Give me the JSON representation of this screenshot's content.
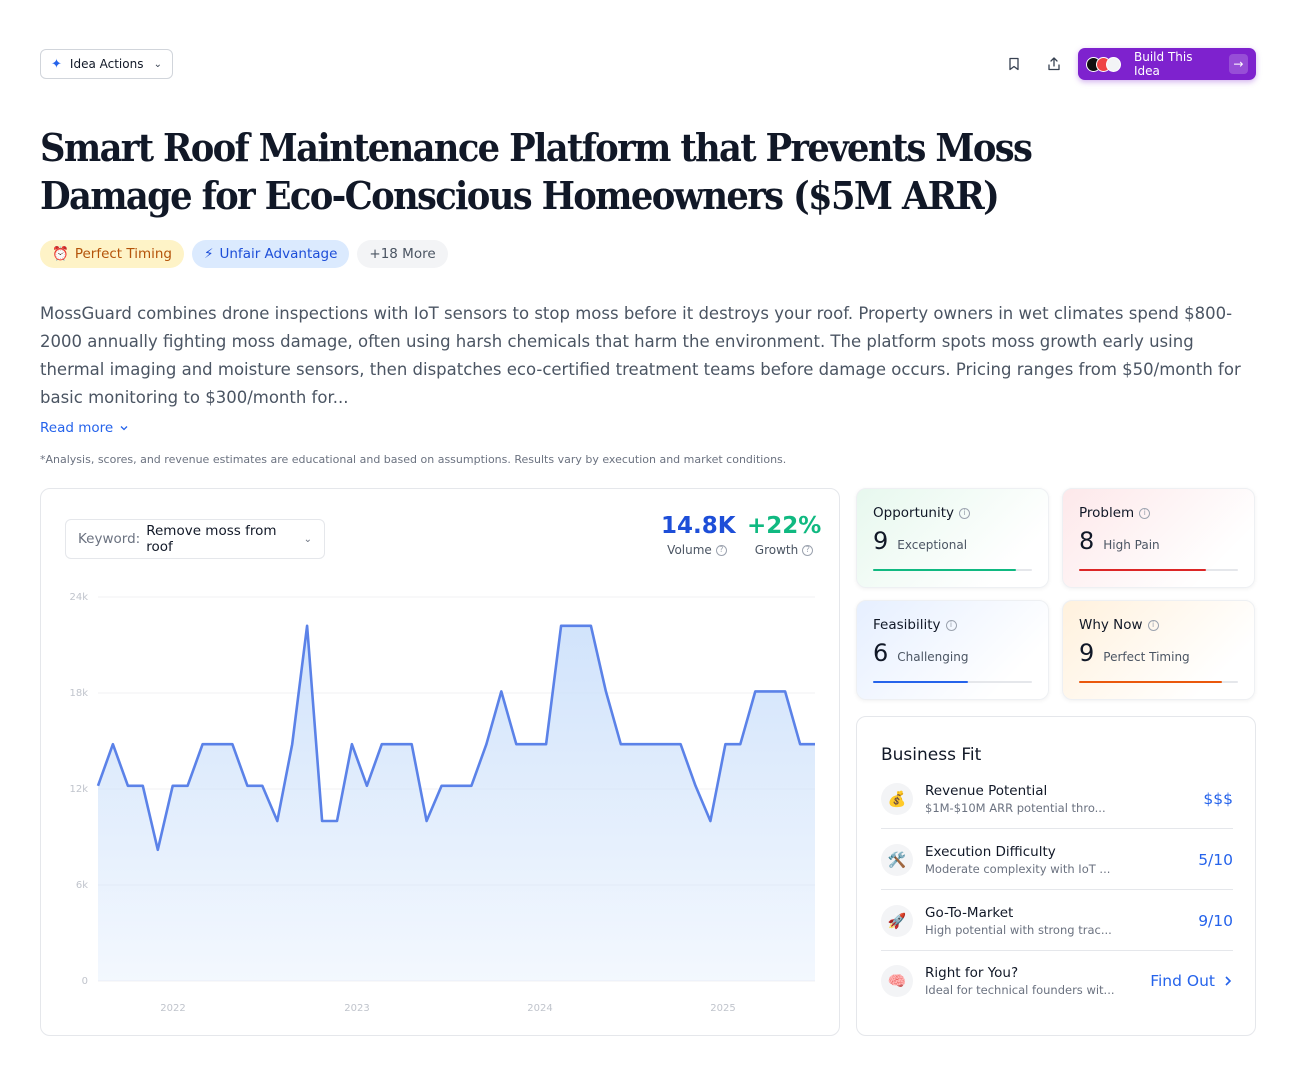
{
  "toolbar": {
    "idea_actions_label": "Idea Actions",
    "build_label": "Build This Idea"
  },
  "title": "Smart Roof Maintenance Platform that Prevents Moss Damage for Eco-Conscious Homeowners ($5M ARR)",
  "tags": [
    {
      "icon": "⏰",
      "label": "Perfect Timing"
    },
    {
      "icon": "⚡",
      "label": "Unfair Advantage"
    },
    {
      "label": "+18 More"
    }
  ],
  "description": "MossGuard combines drone inspections with IoT sensors to stop moss before it destroys your roof. Property owners in wet climates spend $800-2000 annually fighting moss damage, often using harsh chemicals that harm the environment. The platform spots moss growth early using thermal imaging and moisture sensors, then dispatches eco-certified treatment teams before damage occurs. Pricing ranges from $50/month for basic monitoring to $300/month for...",
  "read_more": "Read more",
  "disclaimer": "*Analysis, scores, and revenue estimates are educational and based on assumptions. Results vary by execution and market conditions.",
  "keyword": {
    "label": "Keyword:",
    "value": "Remove moss from roof"
  },
  "metrics": {
    "volume": {
      "value": "14.8K",
      "label": "Volume"
    },
    "growth": {
      "value": "+22%",
      "label": "Growth"
    }
  },
  "chart_data": {
    "type": "area",
    "x_ticks": [
      "2022",
      "2023",
      "2024",
      "2025"
    ],
    "y_ticks": [
      "0",
      "6k",
      "12k",
      "18k",
      "24k"
    ],
    "ylim": [
      0,
      24000
    ],
    "values": [
      12200,
      14800,
      12200,
      12200,
      8200,
      12200,
      12200,
      14800,
      14800,
      14800,
      12200,
      12200,
      10000,
      14800,
      22200,
      10000,
      10000,
      14800,
      12200,
      14800,
      14800,
      14800,
      10000,
      12200,
      12200,
      12200,
      14800,
      18100,
      14800,
      14800,
      14800,
      22200,
      22200,
      22200,
      18100,
      14800,
      14800,
      14800,
      14800,
      14800,
      12200,
      10000,
      14800,
      14800,
      18100,
      18100,
      18100,
      14800,
      14800
    ],
    "line_color": "#5b82e8",
    "fill_color": "#cfe2fb"
  },
  "scores": [
    {
      "title": "Opportunity",
      "value": "9",
      "sub": "Exceptional",
      "fraction": 0.9,
      "color": "#10b981"
    },
    {
      "title": "Problem",
      "value": "8",
      "sub": "High Pain",
      "fraction": 0.8,
      "color": "#dc2626"
    },
    {
      "title": "Feasibility",
      "value": "6",
      "sub": "Challenging",
      "fraction": 0.6,
      "color": "#2563eb"
    },
    {
      "title": "Why Now",
      "value": "9",
      "sub": "Perfect Timing",
      "fraction": 0.9,
      "color": "#ea580c"
    }
  ],
  "business_fit": {
    "title": "Business Fit",
    "rows": [
      {
        "icon": "💰",
        "name": "Revenue Potential",
        "desc": "$1M-$10M ARR potential thro...",
        "value": "$$$"
      },
      {
        "icon": "🛠️",
        "name": "Execution Difficulty",
        "desc": "Moderate complexity with IoT ...",
        "value": "5/10"
      },
      {
        "icon": "🚀",
        "name": "Go-To-Market",
        "desc": "High potential with strong trac...",
        "value": "9/10"
      },
      {
        "icon": "🧠",
        "name": "Right for You?",
        "desc": "Ideal for technical founders wit...",
        "value": "Find Out"
      }
    ]
  }
}
